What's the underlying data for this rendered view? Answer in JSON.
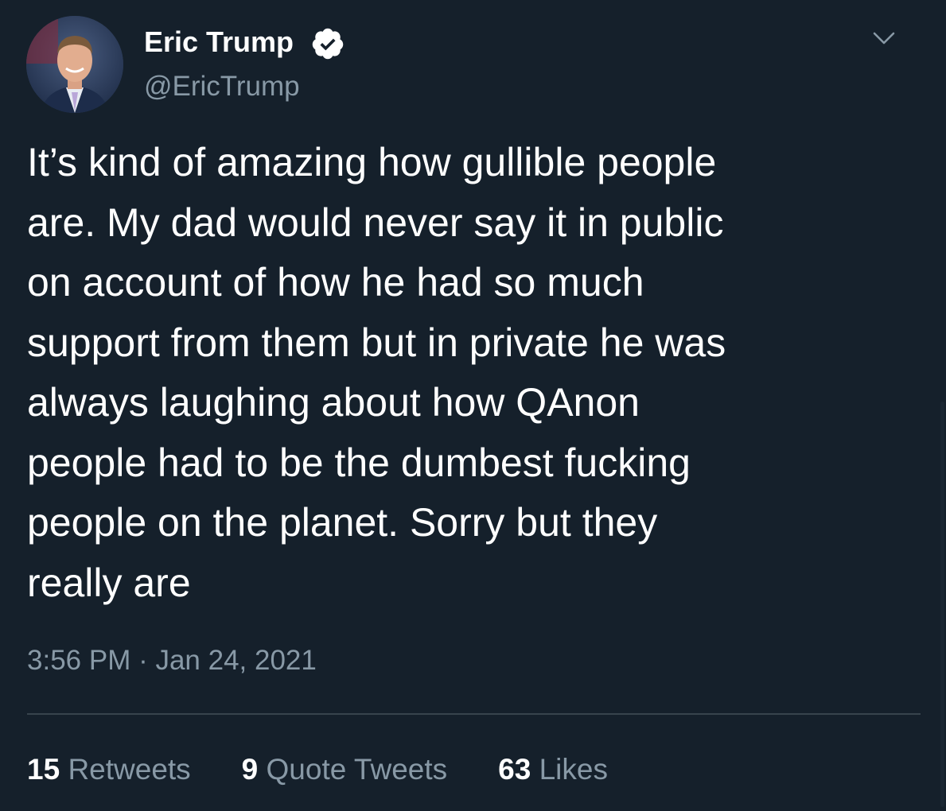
{
  "user": {
    "display_name": "Eric Trump",
    "handle": "@EricTrump",
    "verified": true
  },
  "tweet": {
    "text": "It’s kind of amazing how gullible people\nare. My dad would never say it in public\non account of how he had so much\nsupport from them but in private he was\nalways laughing about how QAnon\npeople had to be the dumbest fucking\npeople on the planet. Sorry but they\nreally are",
    "timestamp": "3:56 PM · Jan 24, 2021"
  },
  "stats": {
    "retweets_count": "15",
    "retweets_label": "Retweets",
    "quotes_count": "9",
    "quotes_label": "Quote Tweets",
    "likes_count": "63",
    "likes_label": "Likes"
  },
  "icons": {
    "verified": "verified-badge-icon",
    "more": "chevron-down-icon"
  },
  "colors": {
    "background": "#15202b",
    "primary_text": "#ffffff",
    "secondary_text": "#8899a6",
    "divider": "#38444d"
  }
}
